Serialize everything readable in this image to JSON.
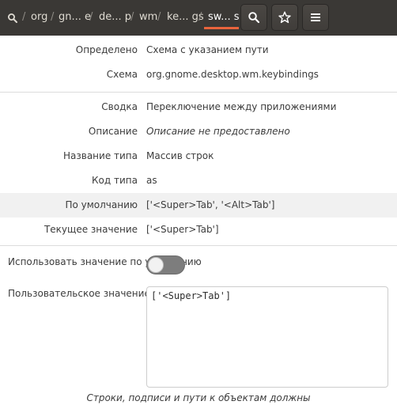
{
  "header": {
    "crumbs": [
      "org",
      "gn... e",
      "de... p",
      "wm",
      "ke... gs"
    ],
    "active_crumb": "sw... s",
    "separator": "/"
  },
  "icons": {
    "left_search": "search-icon",
    "search_button": "search-icon",
    "bookmark_button": "star-icon",
    "menu_button": "hamburger-menu-icon"
  },
  "colors": {
    "header_bg": "#3a3835",
    "accent": "#e9643c"
  },
  "details": {
    "defined_label": "Определено",
    "defined_value": "Схема с указанием пути",
    "schema_label": "Схема",
    "schema_value": "org.gnome.desktop.wm.keybindings",
    "summary_label": "Сводка",
    "summary_value": "Переключение между приложениями",
    "description_label": "Описание",
    "description_value": "Описание не предоставлено",
    "type_name_label": "Название типа",
    "type_name_value": "Массив строк",
    "type_code_label": "Код типа",
    "type_code_value": "as",
    "default_label": "По умолчанию",
    "default_value": "['<Super>Tab', '<Alt>Tab']",
    "current_label": "Текущее значение",
    "current_value": "['<Super>Tab']"
  },
  "use_default": {
    "label": "Использовать значение по умолчанию",
    "enabled": false
  },
  "custom_value": {
    "label": "Пользовательское значение",
    "value": "['<Super>Tab']"
  },
  "footer_note": "Строки, подписи и пути к объектам должны"
}
